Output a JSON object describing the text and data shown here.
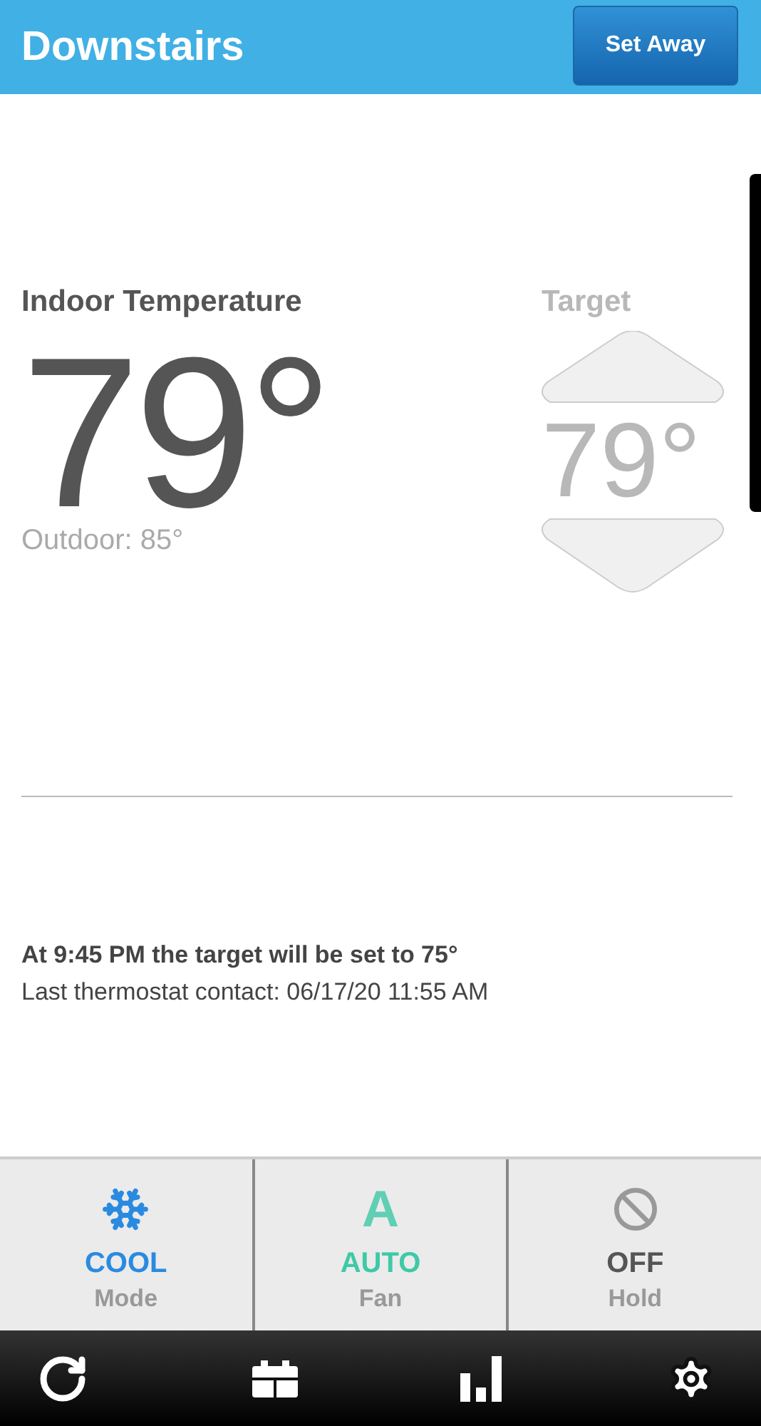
{
  "header": {
    "title": "Downstairs",
    "button": "Set Away"
  },
  "indoor": {
    "label": "Indoor Temperature",
    "temperature": "79°",
    "outdoor": "Outdoor: 85°"
  },
  "target": {
    "label": "Target",
    "temperature": "79°"
  },
  "messages": {
    "schedule": "At 9:45 PM the target will be set to 75°",
    "contact": "Last thermostat contact: 06/17/20 11:55 AM"
  },
  "controls": [
    {
      "kind": "snowflake",
      "value": "COOL",
      "label": "Mode",
      "color": "#2a8ae0"
    },
    {
      "kind": "letter",
      "glyph": "A",
      "value": "AUTO",
      "label": "Fan",
      "color": "#3ec9a7"
    },
    {
      "kind": "blocked",
      "value": "OFF",
      "label": "Hold",
      "color": "#555555"
    }
  ],
  "nav": [
    {
      "kind": "refresh"
    },
    {
      "kind": "calendar"
    },
    {
      "kind": "chart"
    },
    {
      "kind": "settings"
    }
  ]
}
